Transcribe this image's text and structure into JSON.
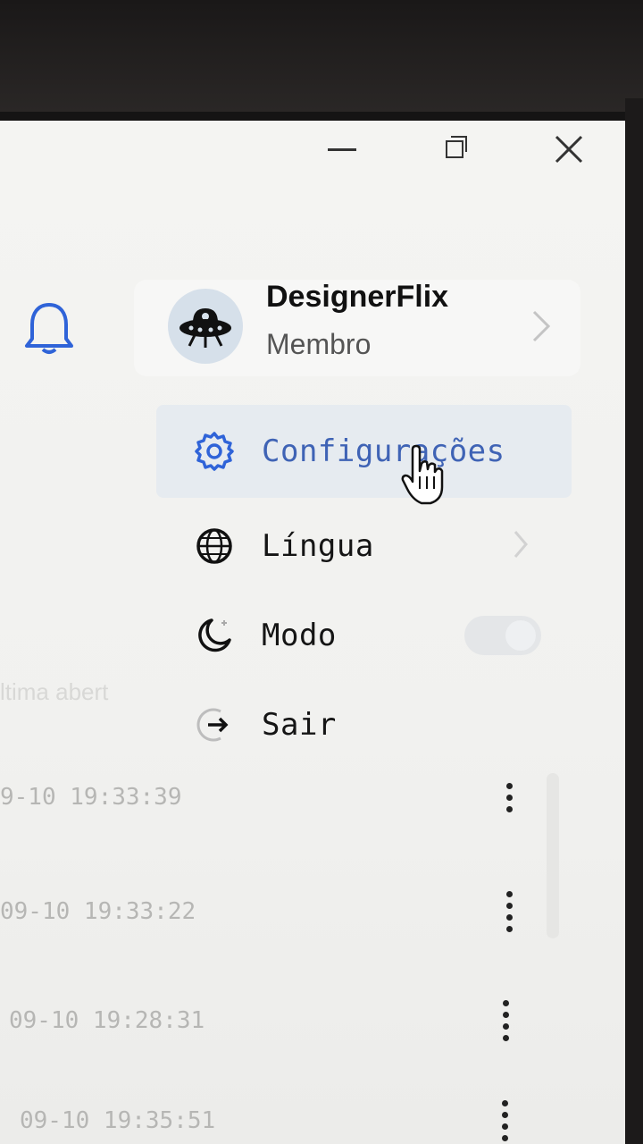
{
  "window": {
    "minimize_icon": "minimize-icon",
    "maximize_icon": "restore-icon",
    "close_icon": "close-icon"
  },
  "header": {
    "bell_icon": "bell-icon",
    "accent_color": "#2f63d8"
  },
  "profile": {
    "name": "DesignerFlix",
    "role": "Membro",
    "avatar_icon": "ufo-avatar-icon"
  },
  "menu": {
    "items": [
      {
        "label": "Configurações",
        "icon": "gear-icon",
        "active": true
      },
      {
        "label": "Língua",
        "icon": "globe-icon"
      },
      {
        "label": "Modo",
        "icon": "moon-icon"
      },
      {
        "label": "Sair",
        "icon": "logout-icon"
      }
    ]
  },
  "list": {
    "column_header": "ltima abert",
    "rows": [
      {
        "time": "9-10 19:33:39"
      },
      {
        "time": "09-10 19:33:22"
      },
      {
        "time": "09-10 19:28:31"
      },
      {
        "time": "09-10 19:35:51"
      }
    ]
  }
}
